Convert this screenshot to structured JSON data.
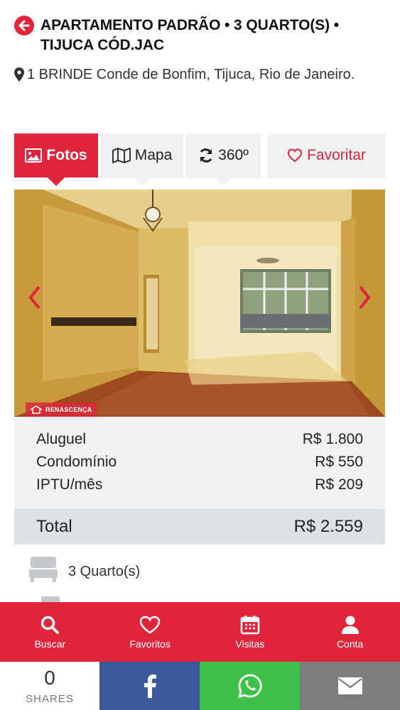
{
  "header": {
    "title": "APARTAMENTO PADRÃO • 3 QUARTO(S) • TIJUCA CÓD.JAC",
    "address": "1 BRINDE Conde de Bonfim, Tijuca, Rio de Janeiro."
  },
  "tabs": [
    {
      "label": "Fotos",
      "icon": "image-icon",
      "active": true
    },
    {
      "label": "Mapa",
      "icon": "map-icon"
    },
    {
      "label": "360º",
      "icon": "refresh-icon"
    },
    {
      "label": "Favoritar",
      "icon": "heart-icon"
    }
  ],
  "photo": {
    "watermark": "RENASCENÇA"
  },
  "prices": {
    "rows": [
      {
        "label": "Aluguel",
        "value": "R$ 1.800"
      },
      {
        "label": "Condomínio",
        "value": "R$ 550"
      },
      {
        "label": "IPTU/mês",
        "value": "R$ 209"
      }
    ],
    "total_label": "Total",
    "total_value": "R$ 2.559"
  },
  "features": [
    {
      "label": "3 Quarto(s)",
      "icon": "bed-icon"
    }
  ],
  "bottom_nav": [
    {
      "label": "Buscar",
      "icon": "search-icon"
    },
    {
      "label": "Favoritos",
      "icon": "heart-icon"
    },
    {
      "label": "Visitas",
      "icon": "calendar-icon"
    },
    {
      "label": "Conta",
      "icon": "user-icon"
    }
  ],
  "share": {
    "count": "0",
    "label": "SHARES"
  },
  "colors": {
    "brand_red": "#e0253b",
    "facebook": "#3b5998",
    "whatsapp": "#3ec14a",
    "email": "#7d7d7d"
  }
}
